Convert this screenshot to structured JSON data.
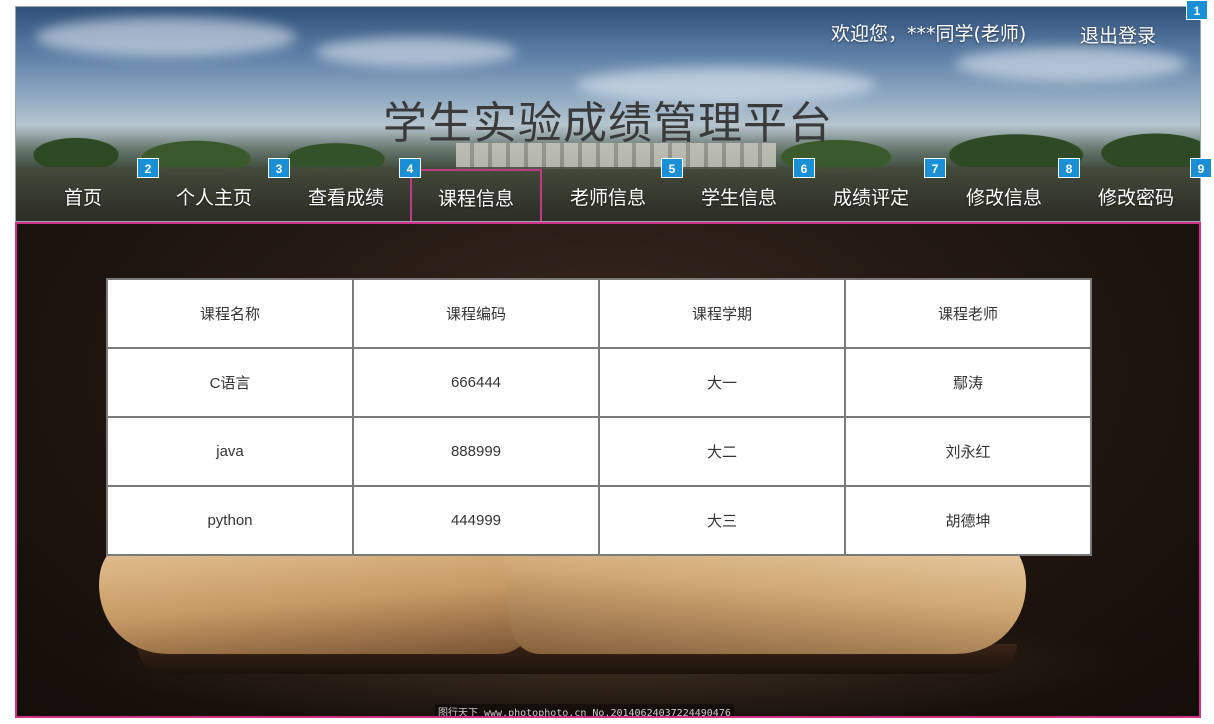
{
  "header": {
    "welcome_text": "欢迎您，***同学(老师)",
    "logout_label": "退出登录",
    "site_title": "学生实验成绩管理平台"
  },
  "nav": {
    "items": [
      {
        "label": "首页"
      },
      {
        "label": "个人主页"
      },
      {
        "label": "查看成绩"
      },
      {
        "label": "课程信息"
      },
      {
        "label": "老师信息"
      },
      {
        "label": "学生信息"
      },
      {
        "label": "成绩评定"
      },
      {
        "label": "修改信息"
      },
      {
        "label": "修改密码"
      }
    ],
    "active_index": 3
  },
  "badges": [
    "1",
    "2",
    "3",
    "4",
    "5",
    "6",
    "7",
    "8",
    "9"
  ],
  "table": {
    "columns": [
      "课程名称",
      "课程编码",
      "课程学期",
      "课程老师"
    ],
    "rows": [
      [
        "C语言",
        "666444",
        "大一",
        "鄢涛"
      ],
      [
        "java",
        "888999",
        "大二",
        "刘永红"
      ],
      [
        "python",
        "444999",
        "大三",
        "胡德坤"
      ]
    ]
  },
  "watermark": "图行天下 www.photophoto.cn No.20140624037224490476",
  "colors": {
    "badge": "#1a8fd6",
    "active_border": "#c03a86",
    "content_border": "#d0308a"
  }
}
